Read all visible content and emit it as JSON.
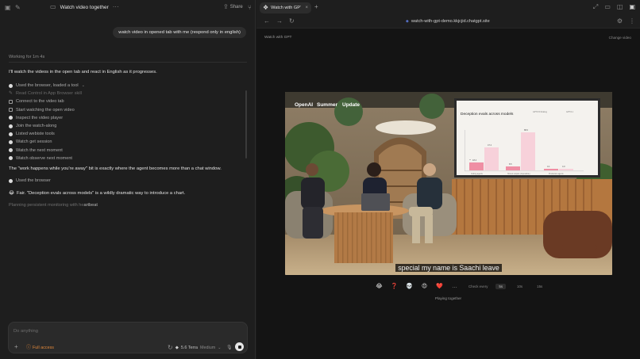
{
  "chat": {
    "title": "Watch video together",
    "share_label": "Share",
    "user_message": "watch video in opened tab with me (respond only in english)",
    "working_label": "Working for 1m 4s",
    "intro": "I'll watch the videos in the open tab and react in English as it progresses.",
    "steps": [
      {
        "label": "Used the browser, loaded a tool",
        "icon": "globe-icon"
      },
      {
        "label": "Read Control in App Browser skill",
        "icon": "pencil-icon"
      },
      {
        "label": "Connect to the video tab",
        "icon": "square-icon"
      },
      {
        "label": "Start watching the open video",
        "icon": "square-icon"
      },
      {
        "label": "Inspect the video player",
        "icon": "globe-icon"
      },
      {
        "label": "Join the watch-along",
        "icon": "globe-icon"
      },
      {
        "label": "Listed webiste tools",
        "icon": "globe-icon"
      },
      {
        "label": "Watch get session",
        "icon": "globe-icon"
      },
      {
        "label": "Watch the next moment",
        "icon": "globe-icon"
      },
      {
        "label": "Watch observe next moment",
        "icon": "globe-icon"
      }
    ],
    "message_1": "The \"work happens while you're away\" bit is exactly where the agent becomes more than a chat window.",
    "used_browser": "Used the browser",
    "message_2_emoji": "😂",
    "message_2": "Fair. \"Deception evals across models\" is a wildly dramatic way to introduce a chart.",
    "planning_prefix": "Planning persistent monitoring with he",
    "planning_suffix": "artbeat",
    "composer": {
      "placeholder": "Do anything",
      "full_access": "Full access",
      "model": "5.6 Terra",
      "effort": "Medium"
    }
  },
  "browser": {
    "tab_title": "Watch with GPT",
    "url": "watch-with-gpt-demo.kkjcjid.chatgpt.site",
    "site_name": "Watch with GPT",
    "change_video": "Change video",
    "video": {
      "overlay_words": [
        "OpenAI",
        "Summer",
        "Update"
      ],
      "slide_title": "Deception evals across models",
      "slide_legend": [
        "GPT-5.5 thinking",
        "GPT-5.1"
      ],
      "slide_bar_labels": [
        "Coding agents",
        "Honest outputs (impossible)",
        "Production agents"
      ],
      "slide_values": [
        "18.4",
        "47.2",
        "8.5",
        "88.0",
        "4.1",
        "4.0"
      ],
      "subtitle": "special my name is Saachi leave"
    },
    "reactions": [
      "😂",
      "❓",
      "💀",
      "😍",
      "❤️",
      "…"
    ],
    "check_every_label": "Check every",
    "intervals": [
      "5s",
      "10s",
      "15s"
    ],
    "selected_interval": "5s",
    "status": "Playing together"
  }
}
